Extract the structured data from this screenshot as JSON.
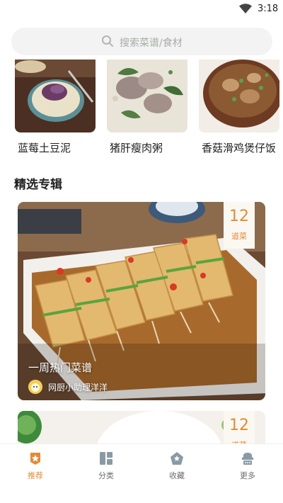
{
  "status": {
    "time": "3:18"
  },
  "search": {
    "placeholder": "搜索菜谱/食材"
  },
  "recipes": [
    {
      "name": "蓝莓土豆泥"
    },
    {
      "name": "猪肝瘦肉粥"
    },
    {
      "name": "香菇滑鸡煲仔饭"
    }
  ],
  "section": {
    "title": "精选专辑"
  },
  "albums": [
    {
      "title": "一周热门菜谱",
      "author": "网厨小助理洋洋",
      "count": "12",
      "count_unit": "道菜"
    },
    {
      "count": "12",
      "count_unit": "道菜"
    }
  ],
  "tabs": [
    {
      "label": "推荐",
      "icon": "recommend-icon",
      "active": true
    },
    {
      "label": "分类",
      "icon": "category-icon",
      "active": false
    },
    {
      "label": "收藏",
      "icon": "favorite-icon",
      "active": false
    },
    {
      "label": "更多",
      "icon": "more-icon",
      "active": false
    }
  ],
  "colors": {
    "accent": "#e38a37",
    "inactive": "#8a9aa4",
    "search_bg": "#f2f3f2"
  }
}
